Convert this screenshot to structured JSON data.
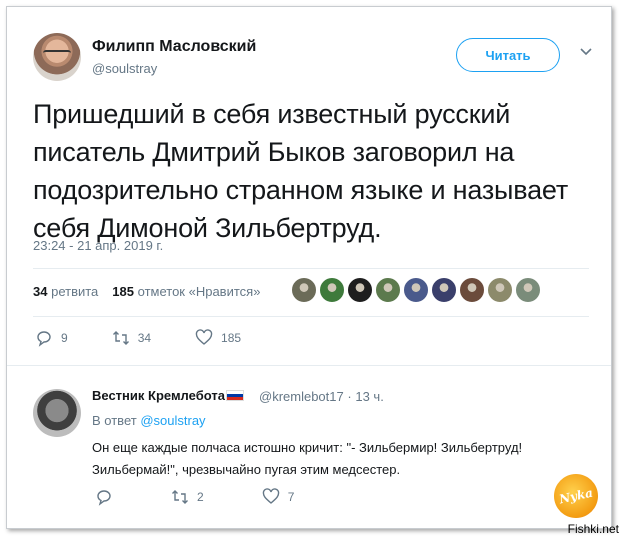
{
  "tweet": {
    "author_name": "Филипп Масловский",
    "author_handle": "@soulstray",
    "follow_label": "Читать",
    "text": "Пришедший в себя известный русский писатель Дмитрий Быков заговорил на подозрительно странном языке и называет себя Димоной Зильбертруд.",
    "timestamp": "23:24 - 21 апр. 2019 г.",
    "retweets_count": "34",
    "retweets_label": "ретвита",
    "likes_count": "185",
    "likes_label": "отметок «Нравится»",
    "liker_avatar_colors": [
      "#6b6b58",
      "#3e7a3b",
      "#1e1e1e",
      "#5c7a4d",
      "#4a5a8c",
      "#3a3f6b",
      "#6b4b3b",
      "#8c8a6b",
      "#7a8c7a"
    ],
    "actions": {
      "replies": "9",
      "retweets": "34",
      "likes": "185"
    }
  },
  "reply": {
    "author_name": "Вестник Кремлебота",
    "author_handle": "@kremlebot17",
    "separator": "·",
    "time": "13 ч.",
    "in_reply_label": "В ответ",
    "in_reply_handle": "@soulstray",
    "text": "Он еще каждые полчаса истошно кричит: \"- Зильбермир! Зильбертруд! Зильбермай!\", чрезвычайно пугая этим медсестер.",
    "actions": {
      "replies": "",
      "retweets": "2",
      "likes": "7"
    }
  },
  "watermarks": {
    "nyka": "Nyka",
    "site": "Fishki.net"
  },
  "colors": {
    "accent": "#1da1f2",
    "secondary_text": "#657786",
    "primary_text": "#14171a"
  }
}
